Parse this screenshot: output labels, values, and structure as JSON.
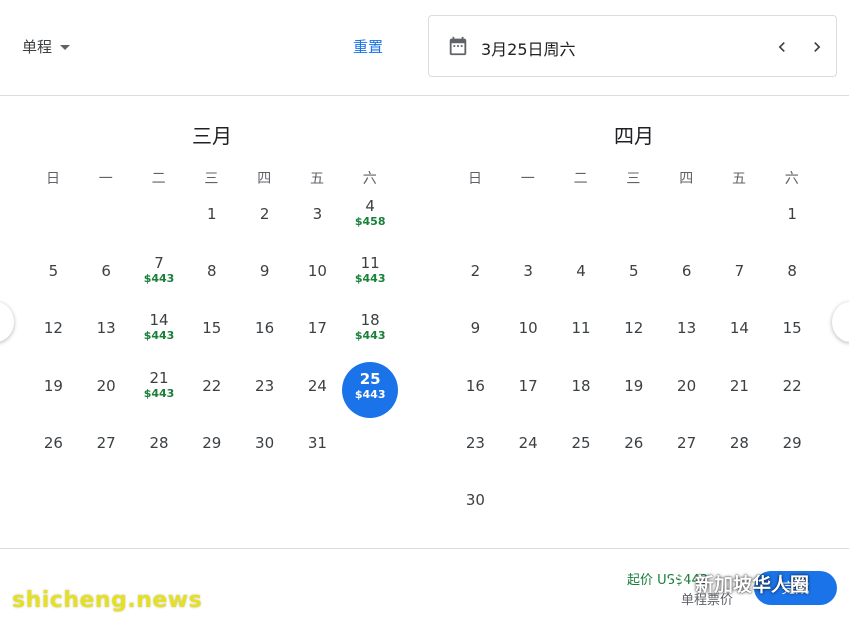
{
  "header": {
    "trip_type": "单程",
    "reset_label": "重置",
    "selected_date": "3月25日周六"
  },
  "weekdays": [
    "日",
    "一",
    "二",
    "三",
    "四",
    "五",
    "六"
  ],
  "months": [
    {
      "title": "三月",
      "first_weekday": 3,
      "days": [
        {
          "num": "1"
        },
        {
          "num": "2"
        },
        {
          "num": "3"
        },
        {
          "num": "4",
          "price": "$458"
        },
        {
          "num": "5"
        },
        {
          "num": "6"
        },
        {
          "num": "7",
          "price": "$443"
        },
        {
          "num": "8"
        },
        {
          "num": "9"
        },
        {
          "num": "10"
        },
        {
          "num": "11",
          "price": "$443"
        },
        {
          "num": "12"
        },
        {
          "num": "13"
        },
        {
          "num": "14",
          "price": "$443"
        },
        {
          "num": "15"
        },
        {
          "num": "16"
        },
        {
          "num": "17"
        },
        {
          "num": "18",
          "price": "$443"
        },
        {
          "num": "19"
        },
        {
          "num": "20"
        },
        {
          "num": "21",
          "price": "$443"
        },
        {
          "num": "22"
        },
        {
          "num": "23"
        },
        {
          "num": "24"
        },
        {
          "num": "25",
          "price": "$443",
          "selected": true
        },
        {
          "num": "26"
        },
        {
          "num": "27"
        },
        {
          "num": "28"
        },
        {
          "num": "29"
        },
        {
          "num": "30"
        },
        {
          "num": "31"
        }
      ]
    },
    {
      "title": "四月",
      "first_weekday": 6,
      "days": [
        {
          "num": "1"
        },
        {
          "num": "2"
        },
        {
          "num": "3"
        },
        {
          "num": "4"
        },
        {
          "num": "5"
        },
        {
          "num": "6"
        },
        {
          "num": "7"
        },
        {
          "num": "8"
        },
        {
          "num": "9"
        },
        {
          "num": "10"
        },
        {
          "num": "11"
        },
        {
          "num": "12"
        },
        {
          "num": "13"
        },
        {
          "num": "14"
        },
        {
          "num": "15"
        },
        {
          "num": "16"
        },
        {
          "num": "17"
        },
        {
          "num": "18"
        },
        {
          "num": "19"
        },
        {
          "num": "20"
        },
        {
          "num": "21"
        },
        {
          "num": "22"
        },
        {
          "num": "23"
        },
        {
          "num": "24"
        },
        {
          "num": "25"
        },
        {
          "num": "26"
        },
        {
          "num": "27"
        },
        {
          "num": "28"
        },
        {
          "num": "29"
        },
        {
          "num": "30"
        }
      ]
    }
  ],
  "footer": {
    "from_price": "起价 US$443",
    "fare_type": "单程票价",
    "done_label": "完成"
  },
  "watermarks": {
    "left": "shicheng.news",
    "right": "新加坡华人圈"
  },
  "colors": {
    "accent": "#1a73e8",
    "price": "#188038"
  },
  "icons": [
    "chevron-down-icon",
    "calendar-icon",
    "chevron-left-icon",
    "chevron-right-icon"
  ]
}
